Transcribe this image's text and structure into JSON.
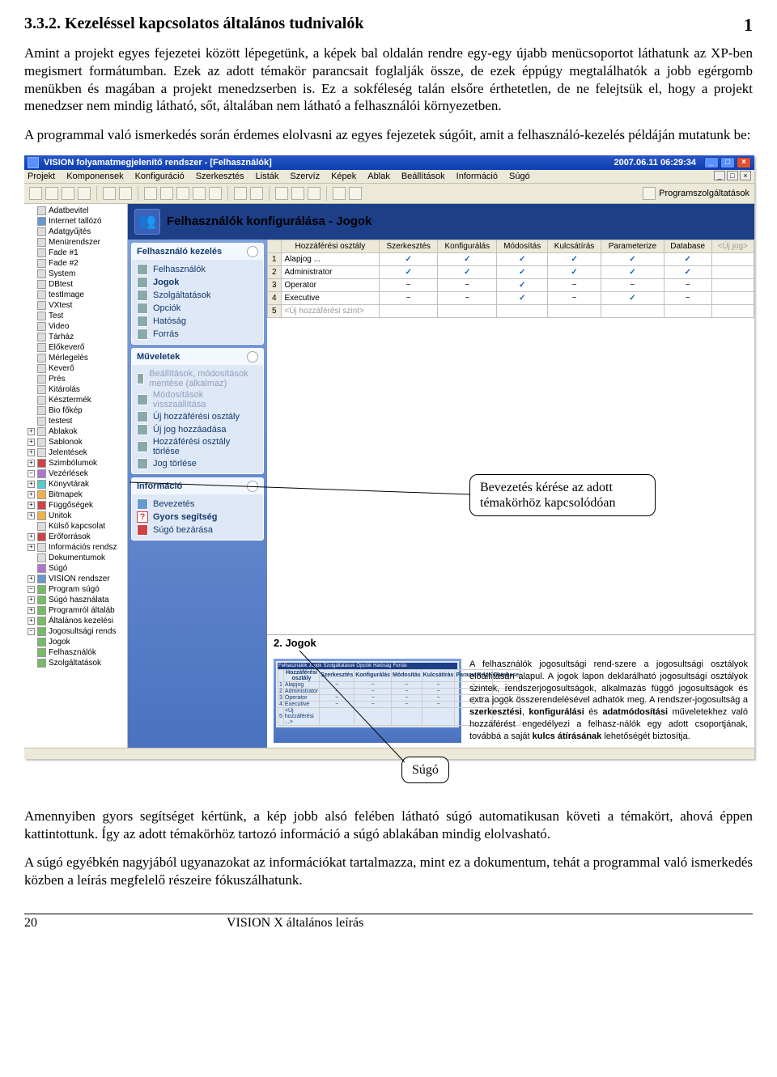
{
  "doc": {
    "page_number_top": "1",
    "section_heading": "3.3.2. Kezeléssel kapcsolatos általános tudnivalók",
    "para1": "Amint a projekt egyes fejezetei között lépegetünk, a képek bal oldalán rendre egy-egy újabb menücsoportot láthatunk az XP-ben megismert formátumban. Ezek az adott témakör parancsait foglalják össze, de ezek éppúgy megtalálhatók a jobb egérgomb menükben és magában a projekt menedzserben is. Ez a sokféleség talán elsőre érthetetlen, de ne felejtsük el, hogy a projekt menedzser nem mindig látható, sőt, általában nem látható a felhasználói környezetben.",
    "para2": "A programmal való ismerkedés során érdemes elolvasni az egyes fejezetek súgóit, amit a felhasználó-kezelés példáján mutatunk be:",
    "para3": "Amennyiben gyors segítséget kértünk, a kép jobb alsó felében látható súgó automatikusan követi a témakört, ahová éppen kattintottunk. Így az adott témakörhöz tartozó információ a súgó ablakában mindig elolvasható.",
    "para4": "A súgó egyébkén nagyjából ugyanazokat az információkat tartalmazza, mint ez a dokumentum, tehát a programmal való ismerkedés közben a leírás megfelelő részeire fókuszálhatunk.",
    "footer_page": "20",
    "footer_text": "VISION X általános leírás"
  },
  "callouts": {
    "c1_line1": "Bevezetés kérése  az  adott",
    "c1_line2": "témakörhöz  kapcsolódóan",
    "c2": "Súgó"
  },
  "app": {
    "title_left": "VISION folyamatmegjelenítő rendszer - [Felhasználók]",
    "title_time": "2007.06.11 06:29:34",
    "menu": [
      "Projekt",
      "Komponensek",
      "Konfiguráció",
      "Szerkesztés",
      "Listák",
      "Szervíz",
      "Képek",
      "Ablak",
      "Beállítások",
      "Információ",
      "Súgó"
    ],
    "toolbar_right_label": "Programszolgáltatások",
    "content_header": "Felhasználók konfigurálása - Jogok",
    "help_section_title": "2. Jogok",
    "help_paragraph": "A felhasználók jogosultsági rend-szere a jogosultsági osztályok előállításán alapul. A jogok lapon deklarálható jogosultsági osztályok szintek, rendszerjogosultságok, alkalmazás függő jogosultságok és extra jogok összerendelésével adhatók meg. A rendszer-jogosultság a szerkesztési, konfigurálási és adatmódosítási műveletekhez való hozzáférést engedélyezi a felhasz-nálók egy adott csoportjának, továbbá a saját kulcs átírásának lehetőségét biztosítja.",
    "help_mini_tabs": [
      "Felhasználók",
      "Jogok",
      "Szolgáltatások",
      "Opciók",
      "Hatóság",
      "Forrás"
    ]
  },
  "tree": [
    {
      "tog": "",
      "ico": "",
      "label": "Adatbevitel"
    },
    {
      "tog": "",
      "ico": "blue",
      "label": "Internet tallózó"
    },
    {
      "tog": "",
      "ico": "",
      "label": "Adatgyűjtés"
    },
    {
      "tog": "",
      "ico": "",
      "label": "Menürendszer"
    },
    {
      "tog": "",
      "ico": "",
      "label": "Fade #1"
    },
    {
      "tog": "",
      "ico": "",
      "label": "Fade #2"
    },
    {
      "tog": "",
      "ico": "",
      "label": "System"
    },
    {
      "tog": "",
      "ico": "",
      "label": "DBtest"
    },
    {
      "tog": "",
      "ico": "",
      "label": "testImage"
    },
    {
      "tog": "",
      "ico": "",
      "label": "VXtest"
    },
    {
      "tog": "",
      "ico": "",
      "label": "Test"
    },
    {
      "tog": "",
      "ico": "",
      "label": "Video"
    },
    {
      "tog": "",
      "ico": "",
      "label": "Tárház"
    },
    {
      "tog": "",
      "ico": "",
      "label": "Előkeverő"
    },
    {
      "tog": "",
      "ico": "",
      "label": "Mérlegelés"
    },
    {
      "tog": "",
      "ico": "",
      "label": "Keverő"
    },
    {
      "tog": "",
      "ico": "",
      "label": "Prés"
    },
    {
      "tog": "",
      "ico": "",
      "label": "Kitárolás"
    },
    {
      "tog": "",
      "ico": "",
      "label": "Késztermék"
    },
    {
      "tog": "",
      "ico": "",
      "label": "Bio főkép"
    },
    {
      "tog": "",
      "ico": "",
      "label": "testest"
    },
    {
      "tog": "+",
      "ico": "",
      "label": "Ablakok"
    },
    {
      "tog": "+",
      "ico": "",
      "label": "Sablonok"
    },
    {
      "tog": "+",
      "ico": "",
      "label": "Jelentések"
    },
    {
      "tog": "+",
      "ico": "red",
      "label": "Szimbólumok"
    },
    {
      "tog": "−",
      "ico": "purple",
      "label": "Vezérlések"
    },
    {
      "tog": "+",
      "ico": "cyan",
      "label": "Könyvtárak"
    },
    {
      "tog": "+",
      "ico": "yellow",
      "label": "Bitmapek"
    },
    {
      "tog": "+",
      "ico": "red",
      "label": "Függőségek"
    },
    {
      "tog": "+",
      "ico": "yellow",
      "label": "Unitok"
    },
    {
      "tog": "",
      "ico": "",
      "label": "Külső kapcsolat"
    },
    {
      "tog": "+",
      "ico": "red",
      "label": "Erőforrások"
    },
    {
      "tog": "+",
      "ico": "",
      "label": "Információs rendsz"
    },
    {
      "tog": "",
      "ico": "",
      "label": "Dokumentumok"
    },
    {
      "tog": "",
      "ico": "purple",
      "label": "Súgó"
    },
    {
      "tog": "+",
      "ico": "blue",
      "label": "VISION rendszer"
    },
    {
      "tog": "−",
      "ico": "green",
      "label": "Program súgó"
    },
    {
      "tog": "+",
      "ico": "green",
      "label": "Súgó használata"
    },
    {
      "tog": "+",
      "ico": "green",
      "label": "Programról általáb"
    },
    {
      "tog": "+",
      "ico": "green",
      "label": "Általános kezelési"
    },
    {
      "tog": "−",
      "ico": "green",
      "label": "Jogosultsági rends"
    },
    {
      "tog": "",
      "ico": "green",
      "label": "Jogok"
    },
    {
      "tog": "",
      "ico": "green",
      "label": "Felhasználók"
    },
    {
      "tog": "",
      "ico": "green",
      "label": "Szolgáltatások"
    }
  ],
  "nav": {
    "panel1_title": "Felhasználó kezelés",
    "panel1_items": [
      {
        "label": "Felhasználók",
        "bold": false
      },
      {
        "label": "Jogok",
        "bold": true
      },
      {
        "label": "Szolgáltatások",
        "bold": false
      },
      {
        "label": "Opciók",
        "bold": false
      },
      {
        "label": "Hatóság",
        "bold": false
      },
      {
        "label": "Forrás",
        "bold": false
      }
    ],
    "panel2_title": "Műveletek",
    "panel2_items": [
      {
        "label": "Beállítások, módosítások mentése (alkalmaz)",
        "grey": true
      },
      {
        "label": "Módosítások visszaállítása",
        "grey": true
      },
      {
        "label": "Új hozzáférési osztály",
        "grey": false
      },
      {
        "label": "Új jog hozzáadása",
        "grey": false
      },
      {
        "label": "Hozzáférési osztály törlése",
        "grey": false
      },
      {
        "label": "Jog törlése",
        "grey": false
      }
    ],
    "panel3_title": "Információ",
    "panel3_items": [
      {
        "label": "Bevezetés",
        "cls": "blue"
      },
      {
        "label": "Gyors segítség",
        "cls": "qm",
        "bold": true
      },
      {
        "label": "Súgó bezárása",
        "cls": "red"
      }
    ]
  },
  "perm": {
    "cols": [
      "Hozzáférési osztály",
      "Szerkesztés",
      "Konfigurálás",
      "Módosítás",
      "Kulcsátírás",
      "Parameterize",
      "Database",
      "<Új jog>"
    ],
    "rows": [
      {
        "n": "1",
        "label": "Alapjog",
        "icon": "...",
        "c": [
          "✓",
          "✓",
          "✓",
          "✓",
          "✓",
          "✓",
          ""
        ]
      },
      {
        "n": "2",
        "label": "Administrator",
        "icon": "",
        "c": [
          "✓",
          "✓",
          "✓",
          "✓",
          "✓",
          "✓",
          ""
        ]
      },
      {
        "n": "3",
        "label": "Operator",
        "icon": "",
        "c": [
          "−",
          "−",
          "✓",
          "−",
          "−",
          "−",
          ""
        ]
      },
      {
        "n": "4",
        "label": "Executive",
        "icon": "",
        "c": [
          "−",
          "−",
          "✓",
          "−",
          "✓",
          "−",
          ""
        ]
      },
      {
        "n": "5",
        "label": "<Új hozzáférési szint>",
        "icon": "",
        "c": [
          "",
          "",
          "",
          "",
          "",
          "",
          ""
        ]
      }
    ],
    "mini_rows": [
      {
        "n": "1",
        "label": "Alapjog",
        "c": [
          "−",
          "−",
          "−",
          "−",
          "−",
          "−"
        ]
      },
      {
        "n": "2",
        "label": "Administrator",
        "c": [
          "−",
          "−",
          "−",
          "−",
          "−",
          "−"
        ]
      },
      {
        "n": "3",
        "label": "Operator",
        "c": [
          "−",
          "−",
          "−",
          "−",
          "−",
          "−"
        ]
      },
      {
        "n": "4",
        "label": "Executive",
        "c": [
          "−",
          "−",
          "−",
          "−",
          "−",
          "−"
        ]
      },
      {
        "n": "5",
        "label": "<Új hozzáférési ...>",
        "c": [
          "",
          "",
          "",
          "",
          "",
          ""
        ]
      }
    ]
  }
}
